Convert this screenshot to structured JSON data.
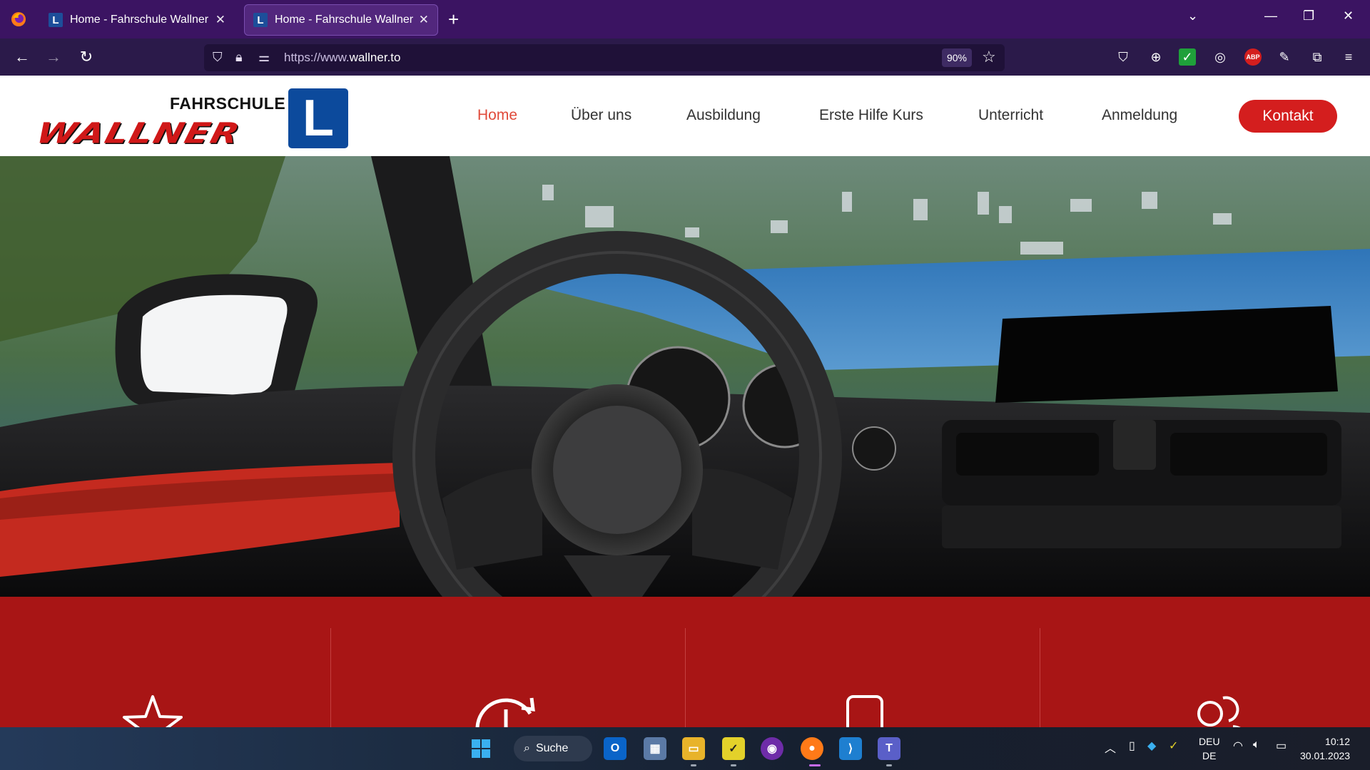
{
  "browser": {
    "tabs": [
      {
        "title": "Home - Fahrschule Wallner | Bre",
        "favicon": "L"
      },
      {
        "title": "Home - Fahrschule Wallner | Br",
        "favicon": "L"
      }
    ],
    "url_prefix": "https://www.",
    "url_domain": "wallner.to",
    "zoom": "90%"
  },
  "site": {
    "logo": {
      "top": "FAHRSCHULE",
      "brand": "WALLNER",
      "badge": "L"
    },
    "nav": [
      {
        "label": "Home"
      },
      {
        "label": "Über uns"
      },
      {
        "label": "Ausbildung"
      },
      {
        "label": "Erste Hilfe Kurs"
      },
      {
        "label": "Unterricht"
      },
      {
        "label": "Anmeldung"
      }
    ],
    "cta": "Kontakt",
    "features_icons": [
      "star-icon",
      "clock-refresh-icon",
      "smartphone-icon",
      "users-icon"
    ]
  },
  "taskbar": {
    "search": "Suche",
    "lang_top": "DEU",
    "lang_bottom": "DE",
    "time": "10:12",
    "date": "30.01.2023"
  },
  "colors": {
    "browser_tabbar": "#3b1462",
    "brand_red": "#d41e1e",
    "band_red": "#a81515",
    "active_nav": "#e04a3a",
    "logo_blue": "#0c4a9c"
  }
}
